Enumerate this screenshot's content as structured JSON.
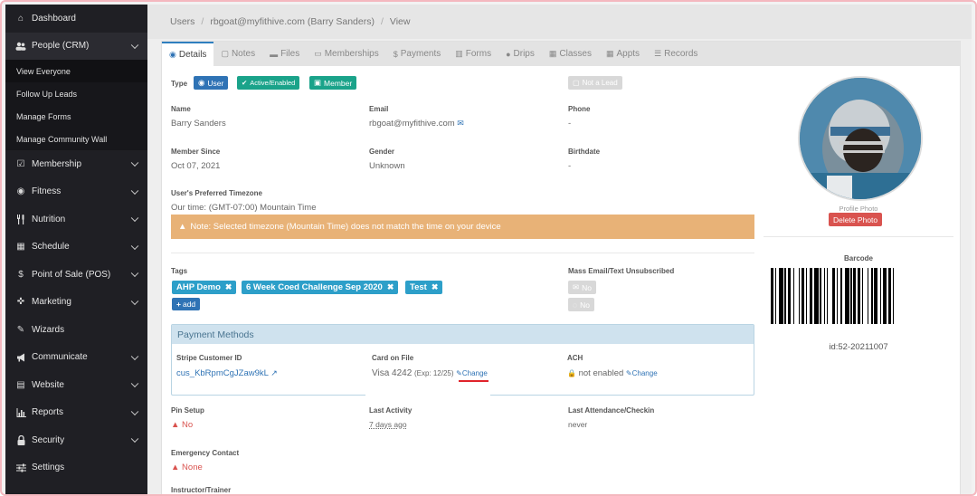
{
  "sidebar": {
    "items": [
      {
        "label": "Dashboard",
        "icon": "home-icon",
        "glyph": "⌂",
        "has_chevron": false
      },
      {
        "label": "People (CRM)",
        "icon": "people-icon",
        "glyph": "👥",
        "has_chevron": true
      }
    ],
    "sub_items": [
      {
        "label": "View Everyone"
      },
      {
        "label": "Follow Up Leads"
      },
      {
        "label": "Manage Forms"
      },
      {
        "label": "Manage Community Wall"
      }
    ],
    "items_after": [
      {
        "label": "Membership",
        "icon": "check-square-icon",
        "glyph": "☑",
        "has_chevron": true
      },
      {
        "label": "Fitness",
        "icon": "fitness-icon",
        "glyph": "◉",
        "has_chevron": true
      },
      {
        "label": "Nutrition",
        "icon": "cutlery-icon",
        "glyph": "🍴",
        "has_chevron": true
      },
      {
        "label": "Schedule",
        "icon": "calendar-icon",
        "glyph": "▦",
        "has_chevron": true
      },
      {
        "label": "Point of Sale (POS)",
        "icon": "dollar-icon",
        "glyph": "$",
        "has_chevron": true
      },
      {
        "label": "Marketing",
        "icon": "crosshair-icon",
        "glyph": "✜",
        "has_chevron": true
      },
      {
        "label": "Wizards",
        "icon": "magic-wand-icon",
        "glyph": "✎",
        "has_chevron": false
      },
      {
        "label": "Communicate",
        "icon": "megaphone-icon",
        "glyph": "📢",
        "has_chevron": true
      },
      {
        "label": "Website",
        "icon": "page-icon",
        "glyph": "▤",
        "has_chevron": true
      },
      {
        "label": "Reports",
        "icon": "bar-chart-icon",
        "glyph": "▮",
        "has_chevron": true
      },
      {
        "label": "Security",
        "icon": "lock-icon",
        "glyph": "🔒",
        "has_chevron": true
      },
      {
        "label": "Settings",
        "icon": "sliders-icon",
        "glyph": "☰",
        "has_chevron": false
      }
    ]
  },
  "breadcrumb": {
    "users": "Users",
    "user": "rbgoat@myfithive.com (Barry Sanders)",
    "view": "View",
    "sep": "/"
  },
  "tabs": [
    {
      "label": "Details",
      "icon": "user-circle-icon",
      "glyph": "◉"
    },
    {
      "label": "Notes",
      "icon": "note-icon",
      "glyph": "▢"
    },
    {
      "label": "Files",
      "icon": "folder-icon",
      "glyph": "▬"
    },
    {
      "label": "Memberships",
      "icon": "id-card-icon",
      "glyph": "▭"
    },
    {
      "label": "Payments",
      "icon": "dollar-icon",
      "glyph": "$"
    },
    {
      "label": "Forms",
      "icon": "forms-icon",
      "glyph": "▥"
    },
    {
      "label": "Drips",
      "icon": "drop-icon",
      "glyph": "●"
    },
    {
      "label": "Classes",
      "icon": "calendar-icon",
      "glyph": "▦"
    },
    {
      "label": "Appts",
      "icon": "calendar-check-icon",
      "glyph": "▦"
    },
    {
      "label": "Records",
      "icon": "list-icon",
      "glyph": "☰"
    }
  ],
  "details": {
    "type_label": "Type",
    "type_user": "User",
    "type_active": "Active/Enabled",
    "type_member": "Member",
    "not_a_lead": "Not a Lead",
    "name_label": "Name",
    "name_value": "Barry Sanders",
    "email_label": "Email",
    "email_value": "rbgoat@myfithive.com",
    "phone_label": "Phone",
    "phone_value": "-",
    "member_since_label": "Member Since",
    "member_since_value": "Oct 07, 2021",
    "gender_label": "Gender",
    "gender_value": "Unknown",
    "birthdate_label": "Birthdate",
    "birthdate_value": "-",
    "timezone_label": "User's Preferred Timezone",
    "timezone_value": "Our time: (GMT-07:00) Mountain Time",
    "timezone_warning": "Note: Selected timezone (Mountain Time) does not match the time on your device",
    "tags_label": "Tags",
    "tags": [
      "AHP Demo",
      "6 Week Coed Challenge Sep 2020",
      "Test"
    ],
    "add_tag": "add",
    "unsubscribed_label": "Mass Email/Text Unsubscribed",
    "unsub_email": "No",
    "unsub_text": "No"
  },
  "payment_methods": {
    "title": "Payment Methods",
    "stripe_label": "Stripe Customer ID",
    "stripe_value": "cus_KbRpmCgJZaw9kL",
    "card_label": "Card on File",
    "card_value": "Visa 4242",
    "card_exp": "(Exp: 12/25)",
    "card_change": "Change",
    "ach_label": "ACH",
    "ach_value": "not enabled",
    "ach_change": "Change"
  },
  "more": {
    "pin_label": "Pin Setup",
    "pin_value": "No",
    "activity_label": "Last Activity",
    "activity_value": "7 days ago",
    "attendance_label": "Last Attendance/Checkin",
    "attendance_value": "never",
    "emergency_label": "Emergency Contact",
    "emergency_value": "None",
    "instructor_label": "Instructor/Trainer"
  },
  "profile": {
    "photo_caption": "Profile Photo",
    "delete_photo": "Delete Photo",
    "barcode_title": "Barcode",
    "barcode_id": "id:52-20211007"
  },
  "colors": {
    "accent_blue": "#2f73b5",
    "teal": "#1aa38a",
    "warning": "#e8b277",
    "danger": "#d9534f",
    "tag": "#2d9fc9",
    "highlight_underline": "#e0232b"
  }
}
